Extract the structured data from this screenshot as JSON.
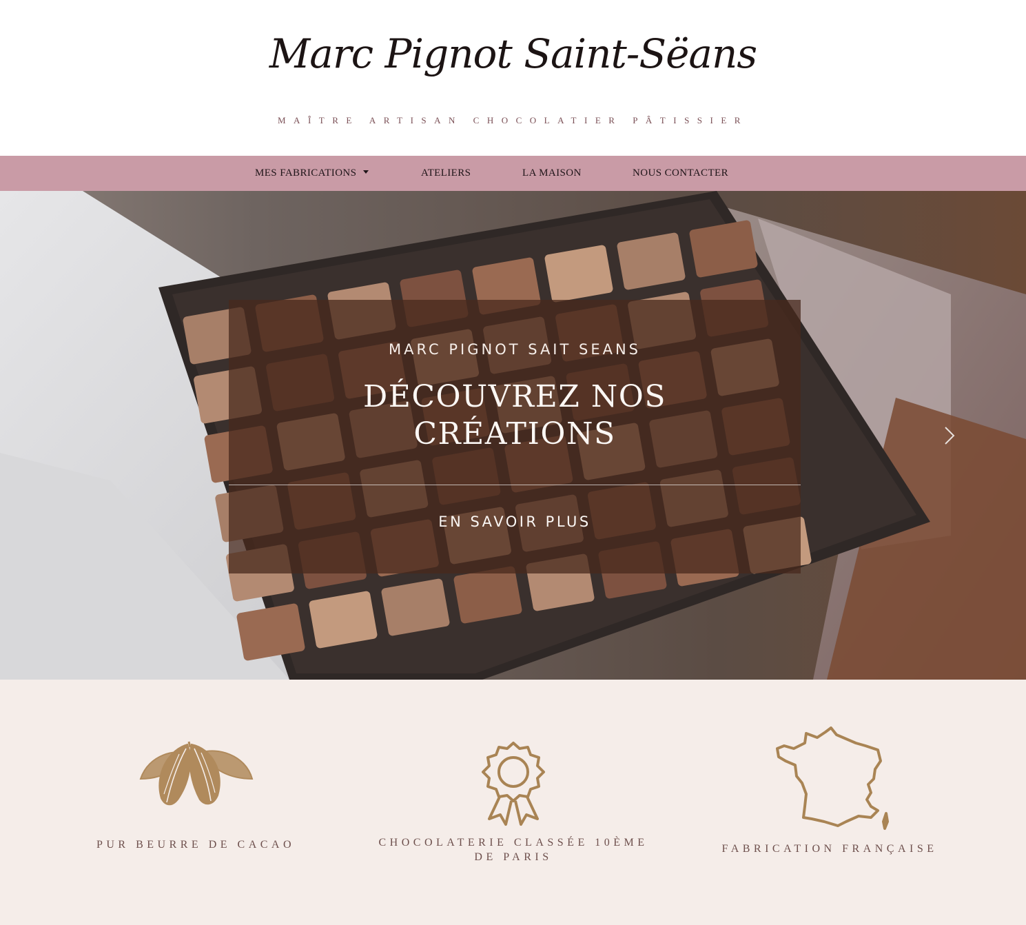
{
  "header": {
    "logo": "Marc Pignot Saint-Sëans",
    "tagline": "MAÎTRE ARTISAN CHOCOLATIER PÂTISSIER"
  },
  "nav": {
    "items": [
      {
        "label": "MES FABRICATIONS",
        "has_dropdown": true
      },
      {
        "label": "ATELIERS"
      },
      {
        "label": "LA MAISON"
      },
      {
        "label": "NOUS CONTACTER"
      }
    ],
    "background": "#c99ba6"
  },
  "hero": {
    "eyebrow": "MARC PIGNOT SAIT SEANS",
    "title_line1": "DÉCOUVREZ NOS",
    "title_line2": "CRÉATIONS",
    "cta": "EN SAVOIR PLUS",
    "next_icon": "chevron-right-icon"
  },
  "features": [
    {
      "icon": "cocoa-pod-icon",
      "label": "PUR BEURRE DE CACAO"
    },
    {
      "icon": "award-rosette-icon",
      "label_line1": "CHOCOLATERIE CLASSÉE 10ÈME",
      "label_line2": "DE PARIS"
    },
    {
      "icon": "france-map-icon",
      "label": "FABRICATION FRANÇAISE"
    }
  ],
  "colors": {
    "features_background": "#f5ede9",
    "icon_gold": "#b08a5c",
    "overlay": "#48281c"
  }
}
